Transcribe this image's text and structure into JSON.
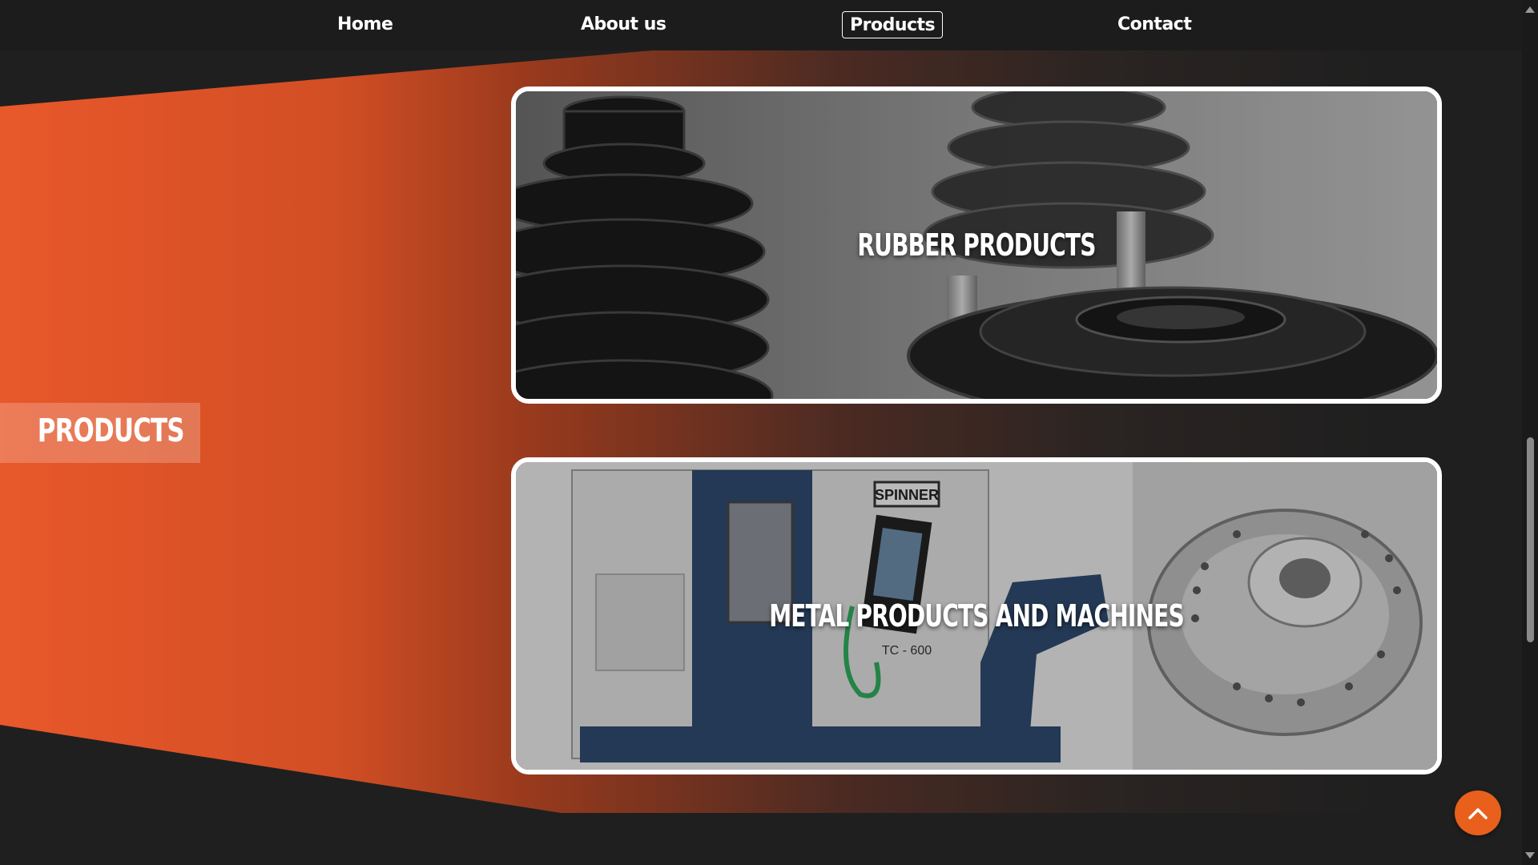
{
  "nav": {
    "items": [
      {
        "label": "Home",
        "active": false
      },
      {
        "label": "About us",
        "active": false
      },
      {
        "label": "Products",
        "active": true
      },
      {
        "label": "Contact",
        "active": false
      }
    ]
  },
  "page": {
    "section_label": "PRODUCTS"
  },
  "cards": [
    {
      "title": "RUBBER PRODUCTS",
      "image": "rubber-bellows-photo"
    },
    {
      "title": "METAL PRODUCTS AND MACHINES",
      "image": "cnc-machine-photo"
    }
  ],
  "machine_photo_text": {
    "brand": "SPINNER",
    "model": "TC - 600"
  },
  "icons": {
    "back_to_top": "chevron-up-icon"
  },
  "colors": {
    "accent": "#e8601c",
    "navbar": "#1c1c1c",
    "background": "#1f1f1f"
  }
}
